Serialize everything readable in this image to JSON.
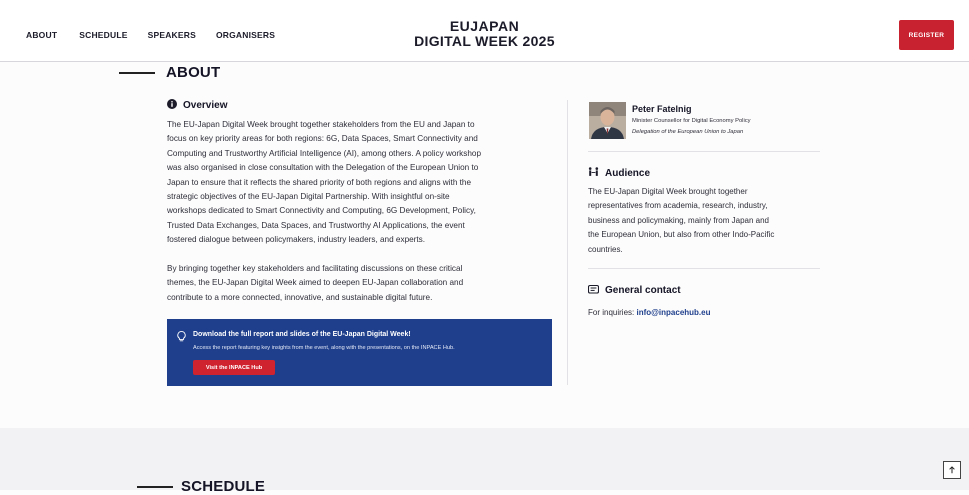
{
  "nav": {
    "items": [
      "ABOUT",
      "SCHEDULE",
      "SPEAKERS",
      "ORGANISERS"
    ],
    "register_label": "REGISTER"
  },
  "brand": {
    "line1": "EUJAPAN",
    "line2": "DIGITAL WEEK 2025"
  },
  "about": {
    "section_title": "ABOUT",
    "overview": {
      "title": "Overview",
      "paragraph1": [
        "The EU-Japan Digital Week brought together stakeholders from the EU and Japan to",
        "focus on key priority areas for both regions: 6G, Data Spaces, Smart Connectivity and",
        "Computing and Trustworthy Artificial Intelligence (AI), among others. A policy workshop",
        "was also organised in close consultation with the Delegation of the European Union to",
        "Japan to ensure that it reflects the shared priority of both regions and aligns with the",
        "strategic objectives of the EU-Japan Digital Partnership. With insightful on-site",
        "workshops dedicated to Smart Connectivity and Computing, 6G Development, Policy,",
        "Trusted Data Exchanges, Data Spaces, and Trustworthy AI Applications, the event",
        "fostered dialogue between policymakers, industry leaders, and experts."
      ],
      "paragraph2": [
        "By bringing together key stakeholders and facilitating discussions on these critical",
        "themes, the EU-Japan Digital Week aimed to deepen EU-Japan collaboration and",
        "contribute to a more connected, innovative, and sustainable digital future."
      ]
    },
    "banner": {
      "title": "Download the full report and slides of the EU-Japan Digital Week!",
      "description": "Access the report featuring key insights from the event, along with the presentations, on the INPACE Hub.",
      "button_label": "Visit the INPACE Hub"
    },
    "speaker": {
      "name": "Peter Fatelnig",
      "role": "Minister Counsellor for Digital Economy Policy",
      "organisation": "Delegation of the European Union to Japan"
    },
    "audience": {
      "title": "Audience",
      "lines": [
        "The EU-Japan Digital Week brought together",
        "representatives from academia, research, industry,",
        "business and policymaking, mainly from Japan and",
        "the European Union, but also from other Indo-Pacific",
        "countries."
      ]
    },
    "contact": {
      "title": "General contact",
      "label": "For inquiries: ",
      "email": "info@inpacehub.eu"
    }
  },
  "schedule": {
    "section_title": "SCHEDULE"
  },
  "colors": {
    "accent_red": "#c8212f",
    "banner_blue": "#1f3f8c",
    "text_dark": "#141426"
  }
}
